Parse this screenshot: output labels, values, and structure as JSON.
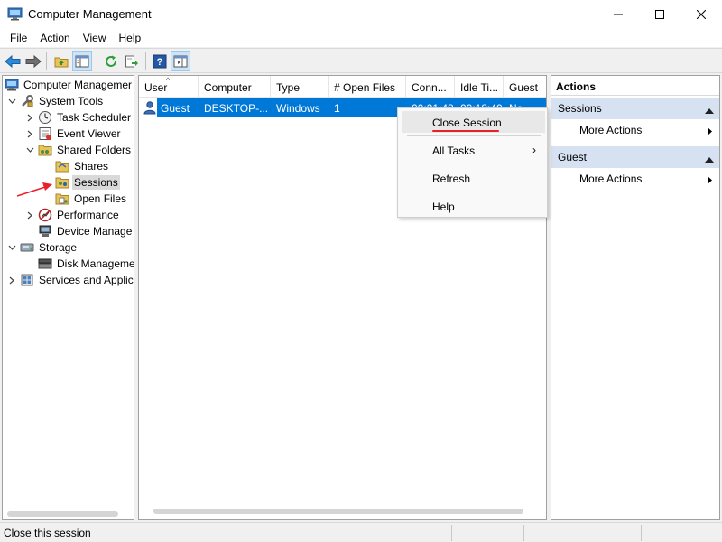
{
  "window": {
    "title": "Computer Management"
  },
  "menu": [
    "File",
    "Action",
    "View",
    "Help"
  ],
  "tree": {
    "items": [
      {
        "label": "Computer Managemer",
        "icon": "computer-management-icon",
        "level": 0,
        "expander": "none"
      },
      {
        "label": "System Tools",
        "icon": "system-tools-icon",
        "level": 1,
        "expander": "expanded"
      },
      {
        "label": "Task Scheduler",
        "icon": "task-scheduler-icon",
        "level": 2,
        "expander": "collapsed"
      },
      {
        "label": "Event Viewer",
        "icon": "event-viewer-icon",
        "level": 2,
        "expander": "collapsed"
      },
      {
        "label": "Shared Folders",
        "icon": "shared-folders-icon",
        "level": 2,
        "expander": "expanded"
      },
      {
        "label": "Shares",
        "icon": "shares-icon",
        "level": 3,
        "expander": "none"
      },
      {
        "label": "Sessions",
        "icon": "sessions-icon",
        "level": 3,
        "expander": "none",
        "selected": true
      },
      {
        "label": "Open Files",
        "icon": "open-files-icon",
        "level": 3,
        "expander": "none"
      },
      {
        "label": "Performance",
        "icon": "performance-icon",
        "level": 2,
        "expander": "collapsed"
      },
      {
        "label": "Device Manage",
        "icon": "device-manager-icon",
        "level": 2,
        "expander": "none"
      },
      {
        "label": "Storage",
        "icon": "storage-icon",
        "level": 1,
        "expander": "expanded"
      },
      {
        "label": "Disk Manageme",
        "icon": "disk-management-icon",
        "level": 2,
        "expander": "none"
      },
      {
        "label": "Services and Applic",
        "icon": "services-icon",
        "level": 1,
        "expander": "collapsed"
      }
    ]
  },
  "list": {
    "columns": [
      "User",
      "Computer",
      "Type",
      "# Open Files",
      "Conn...",
      "Idle Ti...",
      "Guest"
    ],
    "rows": [
      {
        "user": "Guest",
        "computer": "DESKTOP-...",
        "type": "Windows",
        "open_files": "1",
        "connected": "00:21:48",
        "idle": "00:18:40",
        "guest": "No"
      }
    ]
  },
  "context_menu": {
    "items": [
      "Close Session",
      "All Tasks",
      "Refresh",
      "Help"
    ],
    "highlighted": "Close Session",
    "submenu_arrow": "›"
  },
  "actions": {
    "title": "Actions",
    "groups": [
      {
        "label": "Sessions",
        "items": [
          "More Actions"
        ]
      },
      {
        "label": "Guest",
        "items": [
          "More Actions"
        ]
      }
    ]
  },
  "status": {
    "text": "Close this session"
  },
  "colors": {
    "selection": "#0078d7",
    "group_header": "#d6e2f1",
    "annotation": "#e8202a"
  }
}
